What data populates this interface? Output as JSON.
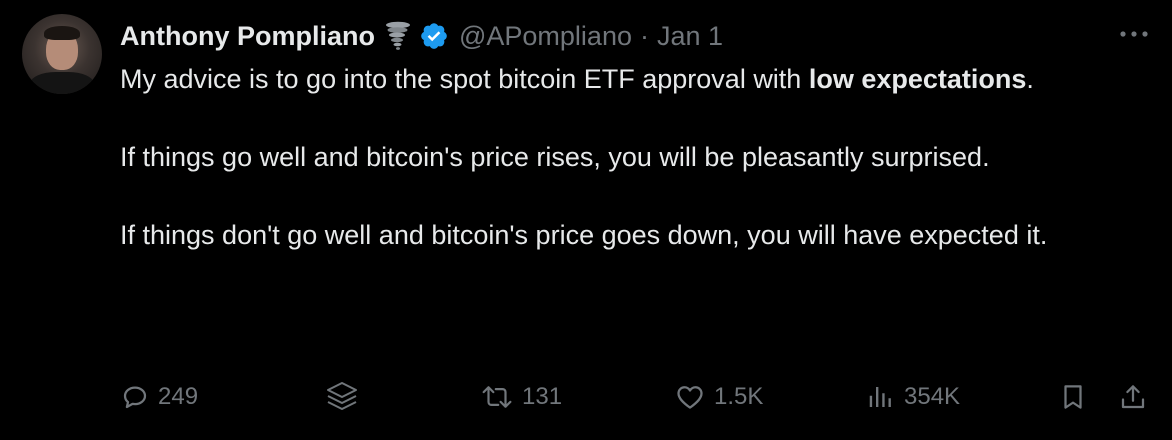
{
  "author": {
    "name": "Anthony Pompliano",
    "handle": "@APompliano",
    "separator": "·",
    "date": "Jan 1"
  },
  "tweet": {
    "line1_prefix": "My advice is to go into the spot bitcoin ETF approval with ",
    "line1_bold": "low expectations",
    "line1_suffix": ".",
    "paragraph2": "If things go well and bitcoin's price rises, you will be pleasantly surprised.",
    "paragraph3": "If things don't go well and bitcoin's price goes down, you will have expected it."
  },
  "actions": {
    "replies": "249",
    "retweets": "131",
    "likes": "1.5K",
    "views": "354K"
  },
  "icons": [
    "avatar",
    "tornado-icon",
    "verified-icon",
    "more-icon",
    "reply-icon",
    "grok-icon",
    "retweet-icon",
    "like-icon",
    "views-icon",
    "bookmark-icon",
    "share-icon"
  ],
  "colors": {
    "background": "#000000",
    "text": "#e7e9ea",
    "muted": "#71767b",
    "verified": "#1d9bf0"
  }
}
